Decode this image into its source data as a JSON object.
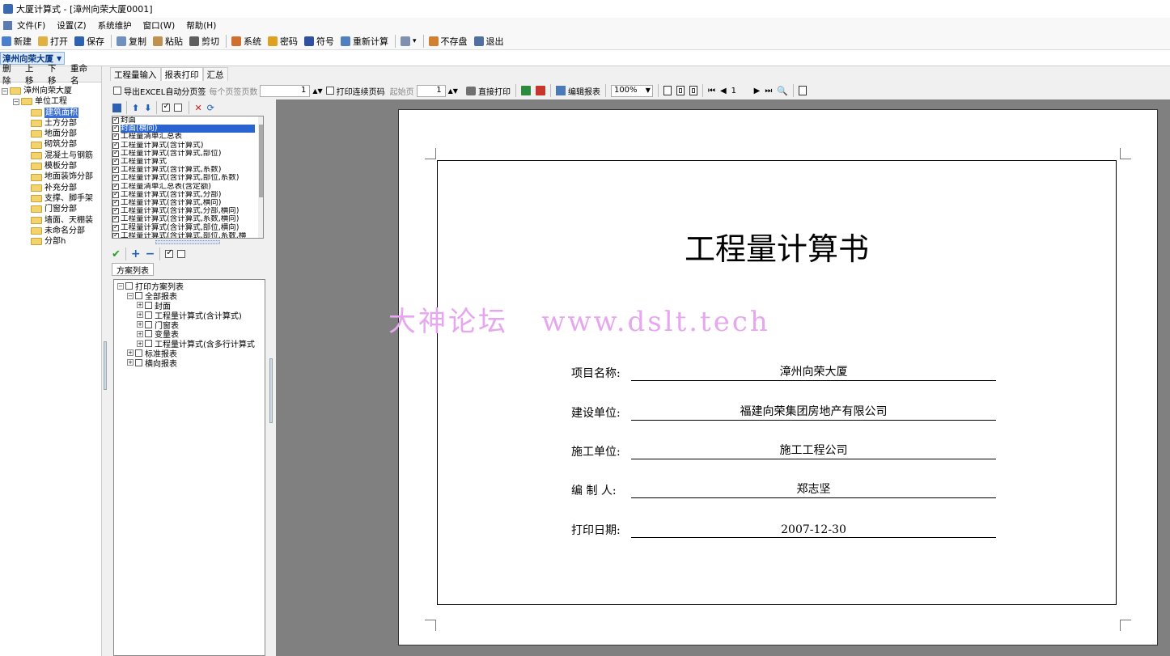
{
  "window": {
    "title": "大厦计算式 - [漳州向荣大厦0001]"
  },
  "menu": [
    "文件(F)",
    "设置(Z)",
    "系统维护",
    "窗口(W)",
    "帮助(H)"
  ],
  "toolbar": [
    {
      "label": "新建",
      "icon": "new-icon",
      "color": "#4a7fd0"
    },
    {
      "label": "打开",
      "icon": "open-icon",
      "color": "#e0b040"
    },
    {
      "label": "保存",
      "icon": "save-icon",
      "color": "#3060b0"
    },
    {
      "label": "复制",
      "icon": "copy-icon",
      "color": "#7090c0"
    },
    {
      "label": "粘贴",
      "icon": "paste-icon",
      "color": "#c09050"
    },
    {
      "label": "剪切",
      "icon": "cut-icon",
      "color": "#606060"
    },
    {
      "label": "系统",
      "icon": "system-icon",
      "color": "#d07030"
    },
    {
      "label": "密码",
      "icon": "key-icon",
      "color": "#e0a020"
    },
    {
      "label": "符号",
      "icon": "pilcrow-icon",
      "color": "#3050a0"
    },
    {
      "label": "重新计算",
      "icon": "calculator-icon",
      "color": "#5080c0"
    },
    {
      "label": "",
      "icon": "dropdown-tool-icon",
      "color": "#8090b0"
    },
    {
      "label": "不存盘",
      "icon": "nosave-icon",
      "color": "#d08030"
    },
    {
      "label": "退出",
      "icon": "exit-icon",
      "color": "#5070a0"
    }
  ],
  "project_selector": "漳州向荣大厦",
  "left_buttons": [
    "删除",
    "上移",
    "下移",
    "重命名"
  ],
  "tree": {
    "root": "漳州向荣大厦",
    "unit": "单位工程",
    "items": [
      "建筑面积",
      "土方分部",
      "地面分部",
      "砌筑分部",
      "混凝土与钢筋",
      "模板分部",
      "地面装饰分部",
      "补充分部",
      "支撑、脚手架",
      "门窗分部",
      "墙面、天棚装",
      "未命名分部",
      "分部h"
    ],
    "selected": "建筑面积"
  },
  "tabs": [
    "工程量输入",
    "报表打印",
    "汇总"
  ],
  "active_tab": "报表打印",
  "options": {
    "export_excel": "导出EXCEL自动分页签",
    "per_page_label": "每个页签页数",
    "per_page_value": "1",
    "continuous_label": "打印连续页码",
    "start_page_label": "起始页",
    "start_page_value": "1",
    "direct_print": "直接打印",
    "edit_report": "编辑报表",
    "zoom": "100%",
    "page_num": "1"
  },
  "report_list": [
    {
      "label": "封面",
      "checked": true
    },
    {
      "label": "封面(横向)",
      "checked": true,
      "selected": true
    },
    {
      "label": "工程量清单汇总表",
      "checked": true
    },
    {
      "label": "工程量计算式(含计算式)",
      "checked": true
    },
    {
      "label": "工程量计算式(含计算式,部位)",
      "checked": true
    },
    {
      "label": "工程量计算式",
      "checked": true
    },
    {
      "label": "工程量计算式(含计算式,系数)",
      "checked": true
    },
    {
      "label": "工程量计算式(含计算式,部位,系数)",
      "checked": true
    },
    {
      "label": "工程量清单汇总表(含定额)",
      "checked": true
    },
    {
      "label": "工程量计算式(含计算式,分部)",
      "checked": true
    },
    {
      "label": "工程量计算式(含计算式,横向)",
      "checked": true
    },
    {
      "label": "工程量计算式(含计算式,分部,横向)",
      "checked": true
    },
    {
      "label": "工程量计算式(含计算式,系数,横向)",
      "checked": true
    },
    {
      "label": "工程量计算式(含计算式,部位,横向)",
      "checked": true
    },
    {
      "label": "工程量计算式(含计算式,部位,系数,横",
      "checked": true
    }
  ],
  "plan_tab": "方案列表",
  "plan_tree": [
    {
      "label": "打印方案列表",
      "level": 0
    },
    {
      "label": "全部报表",
      "level": 1
    },
    {
      "label": "封面",
      "level": 2
    },
    {
      "label": "工程量计算式(含计算式)",
      "level": 2
    },
    {
      "label": "门窗表",
      "level": 2
    },
    {
      "label": "变量表",
      "level": 2
    },
    {
      "label": "工程量计算式(含多行计算式",
      "level": 2
    },
    {
      "label": "标准报表",
      "level": 1
    },
    {
      "label": "横向报表",
      "level": 1
    }
  ],
  "document": {
    "title": "工程量计算书",
    "fields": [
      {
        "label": "项目名称:",
        "value": "漳州向荣大厦"
      },
      {
        "label": "建设单位:",
        "value": "福建向荣集团房地产有限公司"
      },
      {
        "label": "施工单位:",
        "value": "施工工程公司"
      },
      {
        "label": "编 制 人:",
        "value": "郑志坚"
      },
      {
        "label": "打印日期:",
        "value": "2007-12-30"
      }
    ]
  },
  "watermark": "大神论坛   www.dslt.tech"
}
